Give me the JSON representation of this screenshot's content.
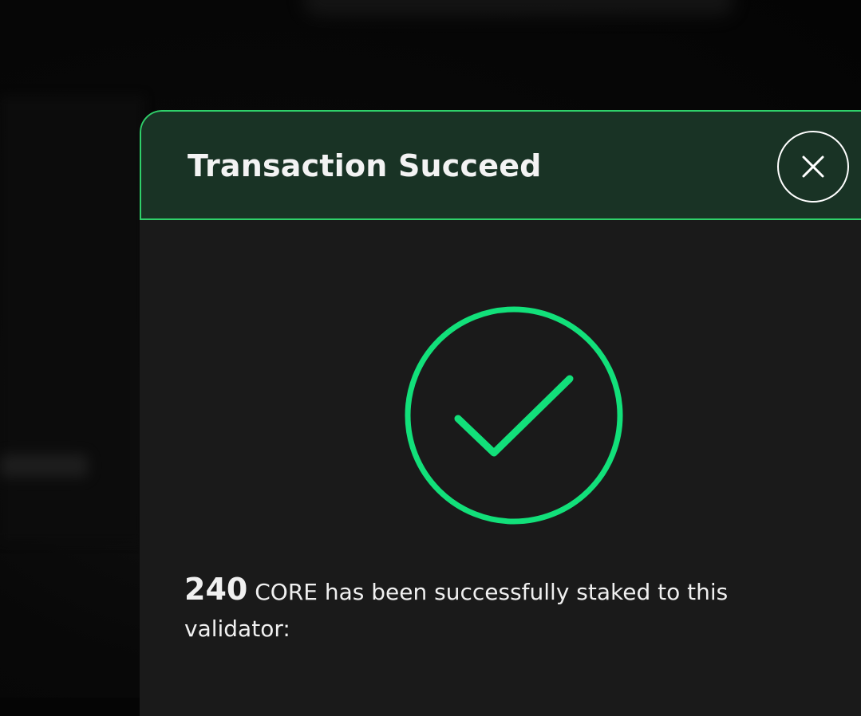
{
  "modal": {
    "title": "Transaction Succeed",
    "close_icon": "close-icon",
    "status_icon": "check-circle-icon",
    "message": {
      "amount": "240",
      "text_before_break": " CORE has been successfully staked to this",
      "text_after_break": "validator:"
    }
  },
  "colors": {
    "accent_green": "#2fd06a",
    "check_green": "#12e07a",
    "header_bg": "#193325",
    "modal_bg": "#1a1a1a",
    "page_bg": "#050505",
    "text": "#f3f3f3"
  }
}
